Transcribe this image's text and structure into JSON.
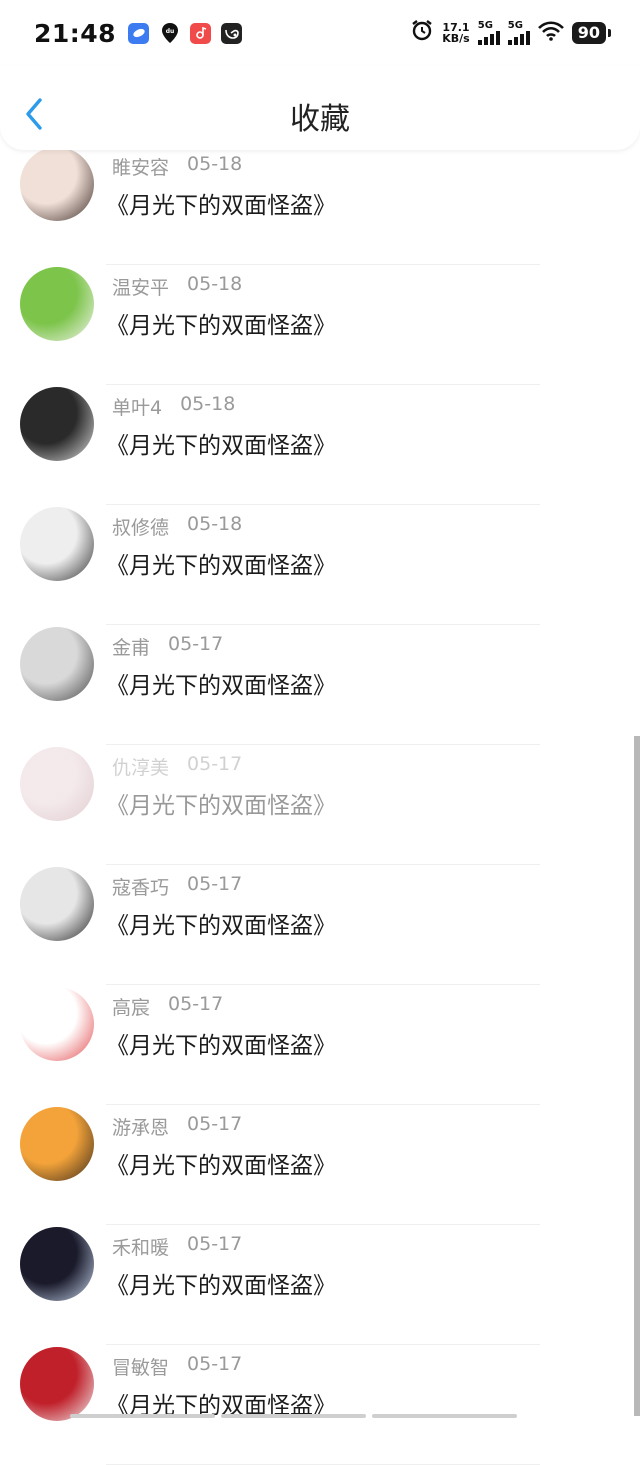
{
  "status_bar": {
    "time": "21:48",
    "net_speed_value": "17.1",
    "net_speed_unit": "KB/s",
    "sim1_label": "5G",
    "sim2_label": "5G",
    "battery": "90",
    "app_icons": [
      "blue-app-icon",
      "du-location-icon",
      "music-app-icon",
      "uc-browser-icon"
    ],
    "icons": [
      "alarm-icon",
      "wifi-icon"
    ]
  },
  "header": {
    "title": "收藏",
    "back_icon": "chevron-left-icon",
    "accent": "#2b9bea"
  },
  "items": [
    {
      "name": "睢安容",
      "date": "05-18",
      "book": "《月光下的双面怪盗》",
      "avatar_colors": [
        "#f0e0d8",
        "#3a2a24"
      ]
    },
    {
      "name": "温安平",
      "date": "05-18",
      "book": "《月光下的双面怪盗》",
      "avatar_colors": [
        "#7cc44a",
        "#f5f5f0"
      ]
    },
    {
      "name": "单叶4",
      "date": "05-18",
      "book": "《月光下的双面怪盗》",
      "avatar_colors": [
        "#2a2a2a",
        "#e0e0e0"
      ]
    },
    {
      "name": "叔修德",
      "date": "05-18",
      "book": "《月光下的双面怪盗》",
      "avatar_colors": [
        "#eeeeee",
        "#2f2f2f"
      ]
    },
    {
      "name": "金甫",
      "date": "05-17",
      "book": "《月光下的双面怪盗》",
      "avatar_colors": [
        "#d9d9d9",
        "#444444"
      ]
    },
    {
      "name": "仇淳美",
      "date": "05-17",
      "book": "《月光下的双面怪盗》",
      "avatar_colors": [
        "#ead7da",
        "#c9a5ab"
      ]
    },
    {
      "name": "寇香巧",
      "date": "05-17",
      "book": "《月光下的双面怪盗》",
      "avatar_colors": [
        "#e6e6e6",
        "#222222"
      ]
    },
    {
      "name": "高宸",
      "date": "05-17",
      "book": "《月光下的双面怪盗》",
      "avatar_colors": [
        "#ffffff",
        "#e2484b"
      ]
    },
    {
      "name": "游承恩",
      "date": "05-17",
      "book": "《月光下的双面怪盗》",
      "avatar_colors": [
        "#f3a33a",
        "#3a2a1a"
      ]
    },
    {
      "name": "禾和暖",
      "date": "05-17",
      "book": "《月光下的双面怪盗》",
      "avatar_colors": [
        "#1a1a2a",
        "#c8d8f0"
      ]
    },
    {
      "name": "冒敏智",
      "date": "05-17",
      "book": "《月光下的双面怪盗》",
      "avatar_colors": [
        "#c0202a",
        "#f0f0f0"
      ]
    }
  ]
}
